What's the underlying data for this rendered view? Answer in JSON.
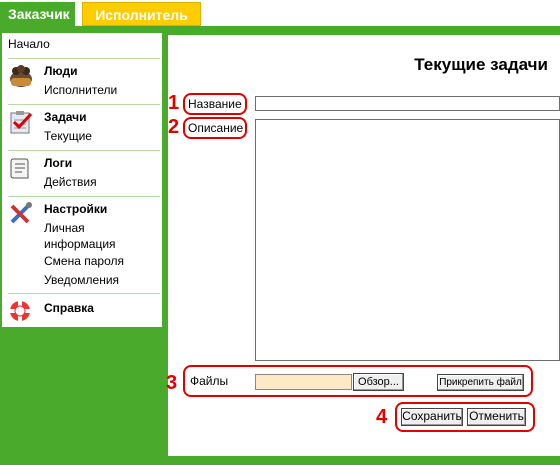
{
  "tabs": [
    {
      "label": "Заказчик"
    },
    {
      "label": "Исполнитель"
    }
  ],
  "sidebar": {
    "home": "Начало",
    "groups": [
      {
        "title": "Люди",
        "items": [
          "Исполнители"
        ],
        "icon": "people-icon"
      },
      {
        "title": "Задачи",
        "items": [
          "Текущие"
        ],
        "icon": "tasks-icon"
      },
      {
        "title": "Логи",
        "items": [
          "Действия"
        ],
        "icon": "logs-icon"
      },
      {
        "title": "Настройки",
        "items": [
          "Личная информация",
          "Смена пароля",
          "Уведомления"
        ],
        "icon": "settings-icon"
      },
      {
        "title": "Справка",
        "items": [],
        "icon": "help-icon"
      }
    ]
  },
  "main": {
    "title": "Текущие задачи",
    "fields": {
      "name_label": "Название",
      "name_value": "",
      "description_label": "Описание",
      "description_value": "",
      "files_label": "Файлы",
      "browse_label": "Обзор...",
      "attach_label": "Прикрепить файл"
    },
    "actions": {
      "save_label": "Сохранить",
      "cancel_label": "Отменить"
    },
    "annotations": [
      "1",
      "2",
      "3",
      "4"
    ]
  },
  "colors": {
    "accent_green": "#4aaa2c",
    "tab_yellow": "#ffcc00",
    "annotation_red": "#e00000",
    "file_field": "#fde9c5"
  }
}
